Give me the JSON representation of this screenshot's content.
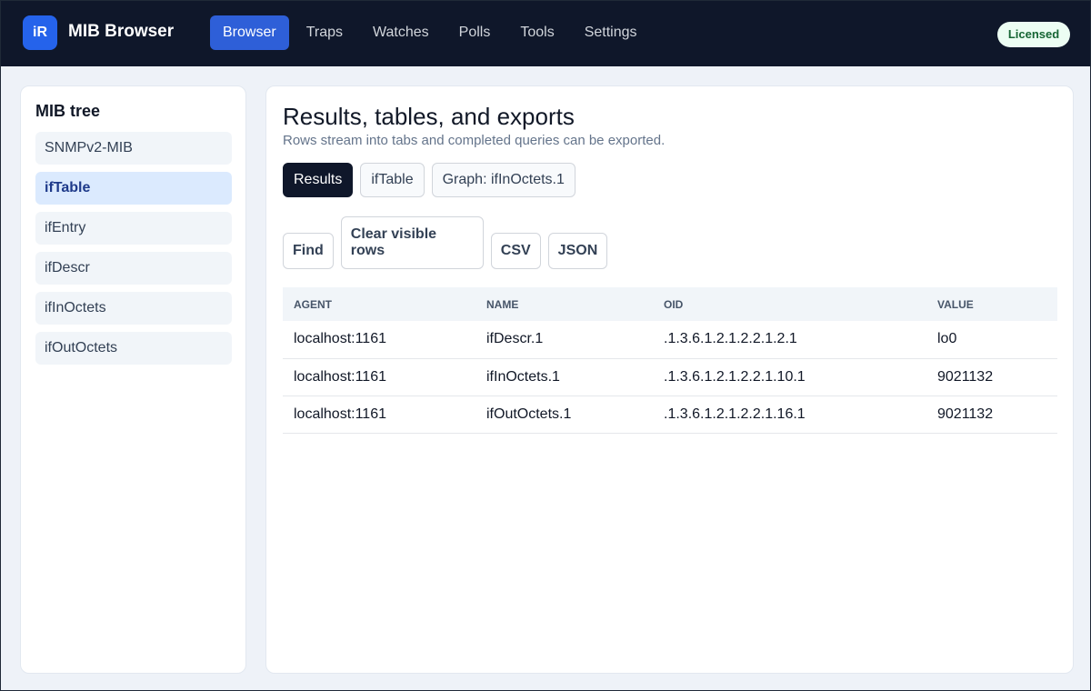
{
  "app": {
    "logo_text": "iR",
    "title": "MIB Browser",
    "license_badge": "Licensed"
  },
  "nav": {
    "items": [
      {
        "label": "Browser",
        "active": true
      },
      {
        "label": "Traps",
        "active": false
      },
      {
        "label": "Watches",
        "active": false
      },
      {
        "label": "Polls",
        "active": false
      },
      {
        "label": "Tools",
        "active": false
      },
      {
        "label": "Settings",
        "active": false
      }
    ]
  },
  "sidebar": {
    "title": "MIB tree",
    "items": [
      {
        "label": "SNMPv2-MIB",
        "selected": false
      },
      {
        "label": "ifTable",
        "selected": true
      },
      {
        "label": "ifEntry",
        "selected": false
      },
      {
        "label": "ifDescr",
        "selected": false
      },
      {
        "label": "ifInOctets",
        "selected": false
      },
      {
        "label": "ifOutOctets",
        "selected": false
      }
    ]
  },
  "main": {
    "title": "Results, tables, and exports",
    "subtitle": "Rows stream into tabs and completed queries can be exported.",
    "tabs": [
      {
        "label": "Results",
        "active": true
      },
      {
        "label": "ifTable",
        "active": false
      },
      {
        "label": "Graph: ifInOctets.1",
        "active": false
      }
    ],
    "actions": {
      "find": "Find",
      "clear": "Clear visible rows",
      "csv": "CSV",
      "json": "JSON"
    },
    "table": {
      "headers": [
        "AGENT",
        "NAME",
        "OID",
        "VALUE"
      ],
      "rows": [
        [
          "localhost:1161",
          "ifDescr.1",
          ".1.3.6.1.2.1.2.2.1.2.1",
          "lo0"
        ],
        [
          "localhost:1161",
          "ifInOctets.1",
          ".1.3.6.1.2.1.2.2.1.10.1",
          "9021132"
        ],
        [
          "localhost:1161",
          "ifOutOctets.1",
          ".1.3.6.1.2.1.2.2.1.16.1",
          "9021132"
        ]
      ]
    }
  },
  "colors": {
    "topbar": "#0f172a",
    "accent": "#2563eb",
    "active_tab": "#0f172a",
    "license_bg": "#ecfdf3",
    "license_text": "#166534"
  }
}
